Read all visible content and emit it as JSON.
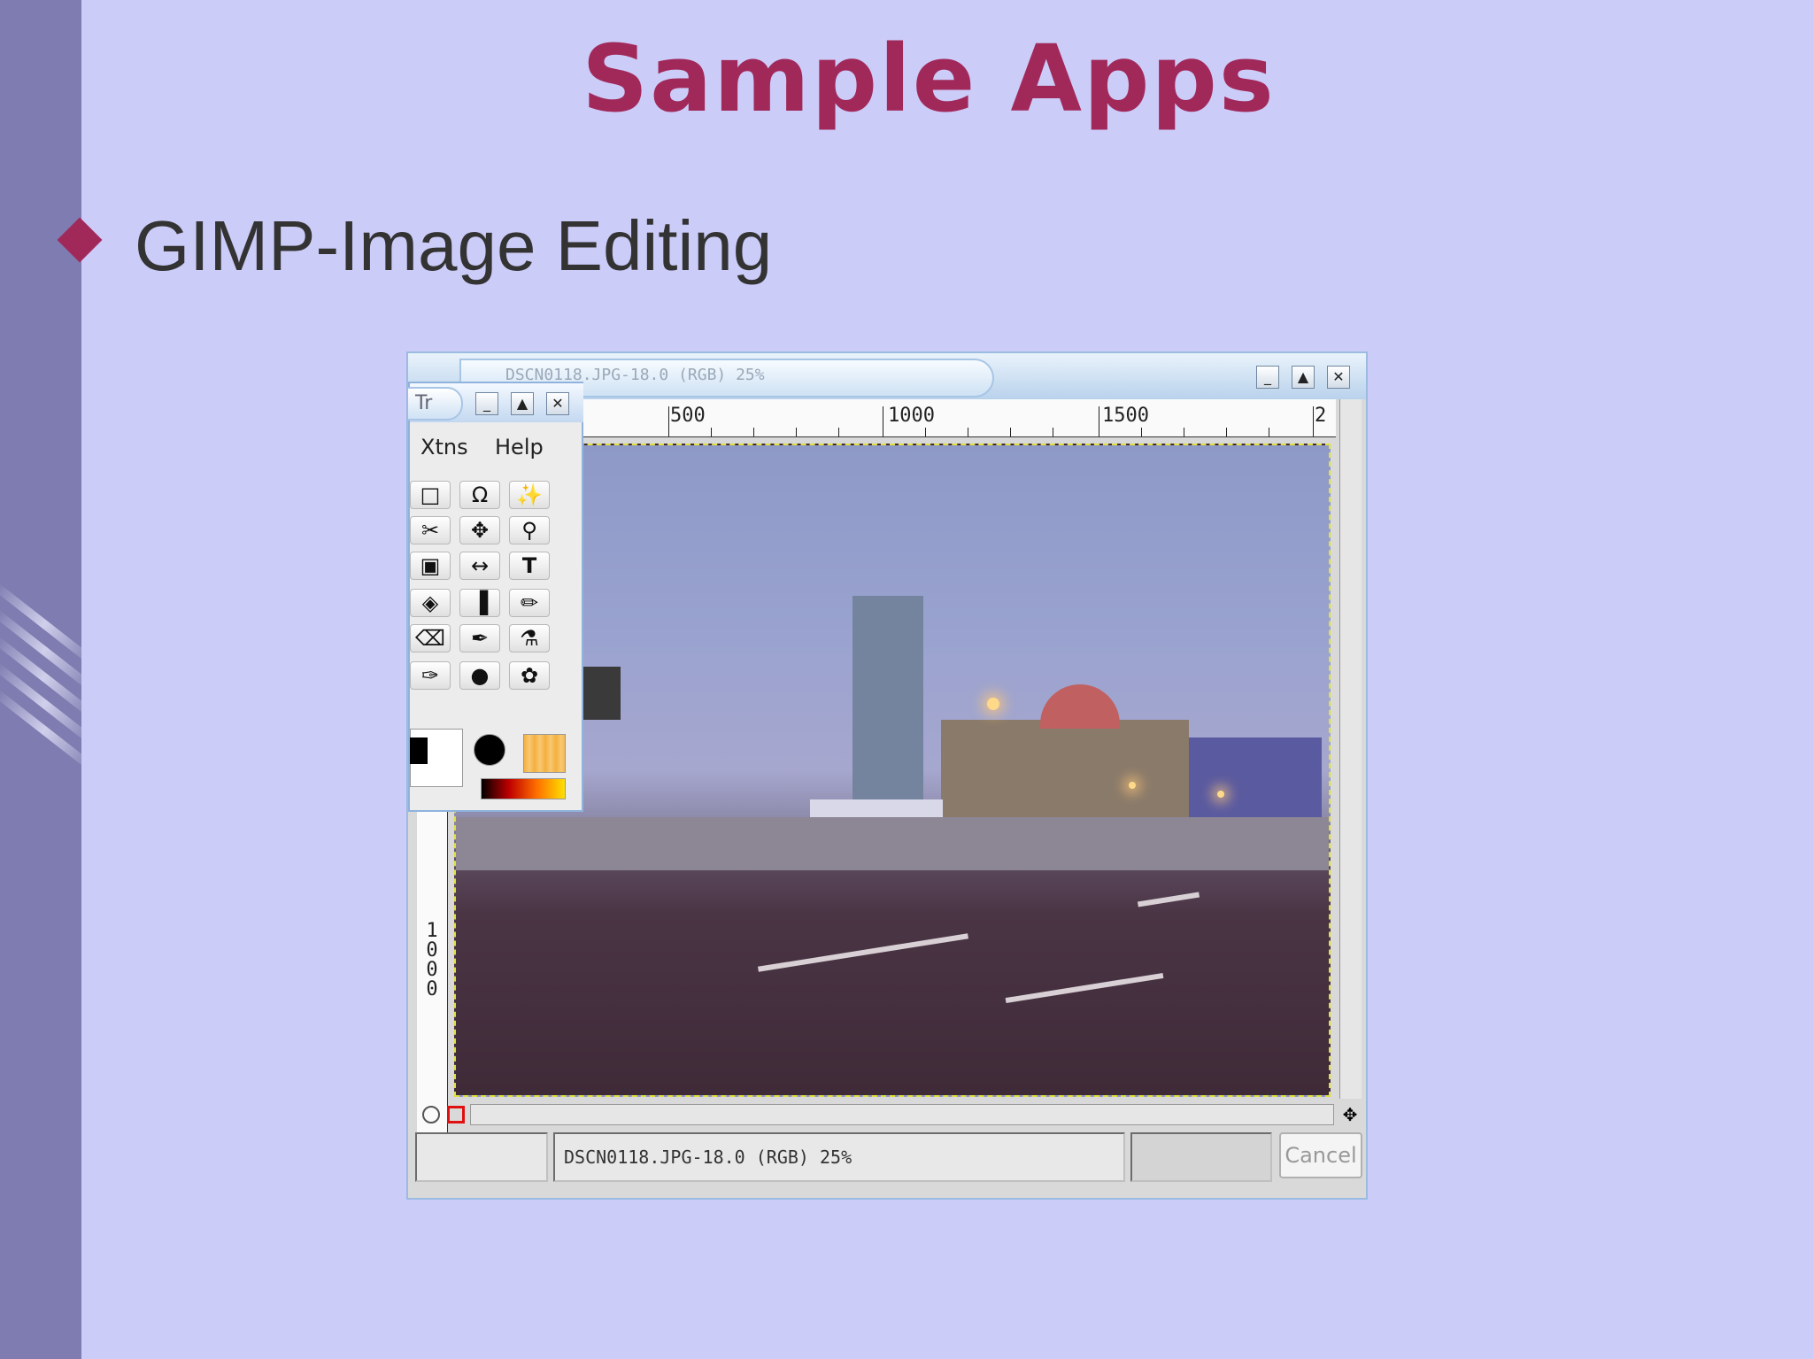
{
  "slide": {
    "title": "Sample Apps",
    "bullet": "GIMP-Image Editing",
    "colors": {
      "background": "#ccccf9",
      "sidebar": "#7e7cb0",
      "accent": "#a1295a",
      "text": "#333333"
    }
  },
  "gimp": {
    "window_title": "DSCN0118.JPG-18.0 (RGB) 25%",
    "window_buttons": [
      "minimize-icon",
      "maximize-icon",
      "close-icon"
    ],
    "ruler_h_labels": [
      "500",
      "1000",
      "1500",
      "2"
    ],
    "ruler_v_label": "1000",
    "status_text": "DSCN0118.JPG-18.0 (RGB) 25%",
    "cancel_label": "Cancel",
    "toolbox": {
      "tab_label": "Tr",
      "menu": [
        "Xtns",
        "Help"
      ],
      "tools": [
        "rect-select-icon",
        "lasso-icon",
        "fuzzy-select-icon",
        "scissors-icon",
        "move-icon",
        "zoom-icon",
        "crop-icon",
        "flip-icon",
        "text-icon",
        "bucket-fill-icon",
        "blend-icon",
        "pencil-icon",
        "eraser-icon",
        "airbrush-icon",
        "clone-icon",
        "smudge-icon",
        "dodge-icon",
        "convolve-icon"
      ]
    }
  }
}
